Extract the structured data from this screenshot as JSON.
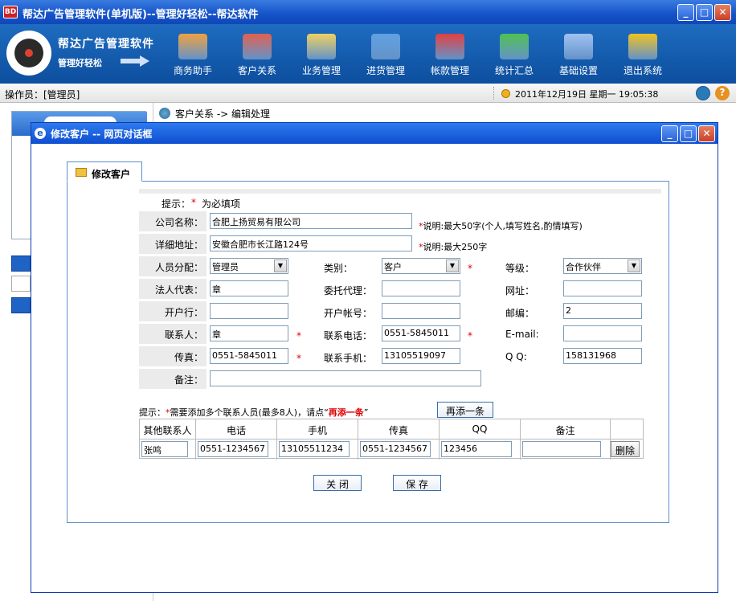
{
  "app": {
    "logo_text": "BD",
    "title": "帮达广告管理软件(单机版)--管理好轻松--帮达软件",
    "brand_name": "帮达广告管理软件",
    "slogan": "管理好轻松"
  },
  "window_controls": {
    "minimize": "_",
    "maximize": "□",
    "close": "✕"
  },
  "nav": [
    {
      "label": "商务助手",
      "icon": "pencil-notepad-icon",
      "color": "#f0a040"
    },
    {
      "label": "客户关系",
      "icon": "people-icon",
      "color": "#e06050"
    },
    {
      "label": "业务管理",
      "icon": "clipboard-icon",
      "color": "#f0d060"
    },
    {
      "label": "进货管理",
      "icon": "edit-document-icon",
      "color": "#60a0e0"
    },
    {
      "label": "帐款管理",
      "icon": "exchange-arrows-icon",
      "color": "#e04040"
    },
    {
      "label": "统计汇总",
      "icon": "bar-chart-icon",
      "color": "#50c050"
    },
    {
      "label": "基础设置",
      "icon": "calendar-icon",
      "color": "#a0c0f0"
    },
    {
      "label": "退出系统",
      "icon": "exit-person-icon",
      "color": "#f0c020"
    }
  ],
  "status": {
    "operator": "操作员：[管理员]",
    "datetime": "2011年12月19日  星期一  19:05:38",
    "help": "?"
  },
  "breadcrumb": "客户关系  ->  编辑处理",
  "dialog": {
    "ie_icon": "e",
    "title": "修改客户  --  网页对话框",
    "tab": "修改客户",
    "hint_label": "提示：",
    "hint_star": "*",
    "hint_text": "为必填项",
    "fields": {
      "company_label": "公司名称：",
      "company_value": "合肥上扬贸易有限公司",
      "company_note_star": "*",
      "company_note": "说明:最大50字(个人,填写姓名,酌情填写)",
      "address_label": "详细地址：",
      "address_value": "安徽合肥市长江路124号",
      "address_note_star": "*",
      "address_note": "说明:最大250字",
      "staff_label": "人员分配：",
      "staff_value": "管理员",
      "category_label": "类别：",
      "category_value": "客户",
      "level_label": "等级：",
      "level_value": "合作伙伴",
      "legal_label": "法人代表：",
      "legal_value": "章",
      "agent_label": "委托代理：",
      "agent_value": "",
      "website_label": "网址：",
      "website_value": "",
      "bank_label": "开户行：",
      "bank_value": "",
      "account_label": "开户帐号：",
      "account_value": "",
      "zip_label": "邮编：",
      "zip_value": "2",
      "contact_label": "联系人：",
      "contact_value": "章",
      "phone_label": "联系电话：",
      "phone_value": "0551-5845011",
      "email_label": "E-mail:",
      "email_value": "",
      "fax_label": "传真：",
      "fax_value": "0551-5845011",
      "mobile_label": "联系手机：",
      "mobile_value": "13105519097",
      "qq_label": "Q Q:",
      "qq_value": "158131968",
      "remark_label": "备注：",
      "remark_value": ""
    },
    "contact_hint_prefix": "提示：",
    "contact_hint_star": "*",
    "contact_hint_text": "需要添加多个联系人员(最多8人)，请点“",
    "contact_hint_link": "再添一条",
    "contact_hint_end": "”",
    "add_row_button": "再添一条",
    "table": {
      "headers": [
        "其他联系人",
        "电话",
        "手机",
        "传真",
        "QQ",
        "备注",
        ""
      ],
      "row": [
        "张鸣",
        "0551-1234567",
        "13105511234",
        "0551-1234567",
        "123456",
        ""
      ],
      "delete_button": "删除"
    },
    "close_button": "关 闭",
    "save_button": "保 存"
  }
}
